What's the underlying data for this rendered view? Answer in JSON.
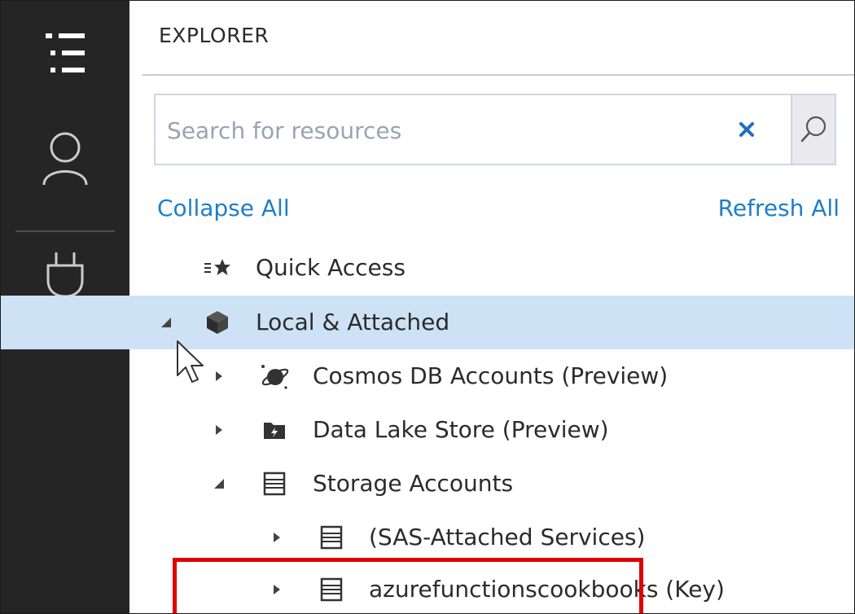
{
  "activity_bar": {
    "items": [
      {
        "name": "explorer",
        "icon": "explorer-list-icon",
        "active": true
      },
      {
        "name": "account",
        "icon": "person-icon"
      },
      {
        "name": "connect",
        "icon": "plug-icon"
      }
    ]
  },
  "explorer": {
    "title": "EXPLORER",
    "search": {
      "placeholder": "Search for resources",
      "value": ""
    },
    "actions": {
      "collapse_all": "Collapse All",
      "refresh_all": "Refresh All"
    },
    "tree": [
      {
        "label": "Quick Access",
        "icon": "quick-access-star-icon",
        "expander": "none",
        "level": 0
      },
      {
        "label": "Local & Attached",
        "icon": "cube-icon",
        "expander": "expanded",
        "level": 0,
        "selected": true
      },
      {
        "label": "Cosmos DB Accounts (Preview)",
        "icon": "planet-icon",
        "expander": "collapsed",
        "level": 1
      },
      {
        "label": "Data Lake Store (Preview)",
        "icon": "data-lake-folder-icon",
        "expander": "collapsed",
        "level": 1
      },
      {
        "label": "Storage Accounts",
        "icon": "storage-icon",
        "expander": "expanded",
        "level": 1
      },
      {
        "label": "(SAS-Attached Services)",
        "icon": "storage-icon",
        "expander": "collapsed",
        "level": 2
      },
      {
        "label": "azurefunctionscookbooks (Key)",
        "icon": "storage-icon",
        "expander": "collapsed",
        "level": 2,
        "highlighted": true
      }
    ]
  },
  "colors": {
    "activity_bar": "#252526",
    "selection": "#cde2f5",
    "link": "#1e7ec8",
    "clear_x": "#1e6fbf",
    "highlight": "#e00000"
  }
}
